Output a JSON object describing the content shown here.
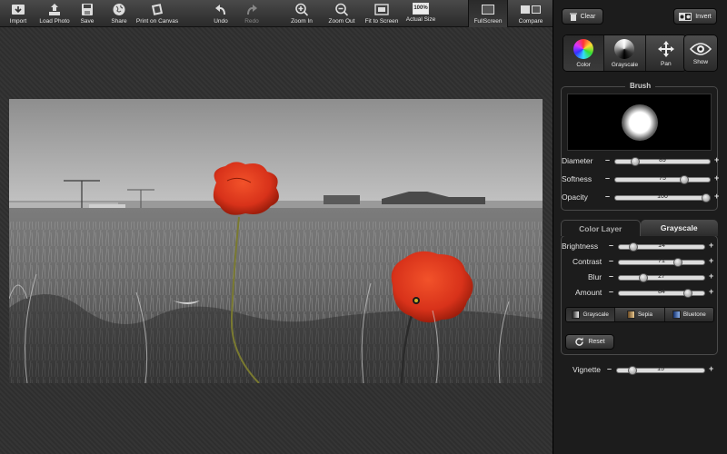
{
  "toolbar": {
    "import": "Import",
    "load_photo": "Load Photo",
    "save": "Save",
    "share": "Share",
    "print_on_canvas": "Print on Canvas",
    "undo": "Undo",
    "redo": "Redo",
    "zoom_in": "Zoom In",
    "zoom_out": "Zoom Out",
    "fit_to_screen": "Fit to Screen",
    "actual_size": "Actual Size",
    "actual_size_icon_text": "100%",
    "fullscreen": "FullScreen",
    "compare": "Compare"
  },
  "panel": {
    "clear": "Clear",
    "invert": "Invert",
    "tools": {
      "color": "Color",
      "grayscale": "Grayscale",
      "pan": "Pan",
      "show": "Show"
    },
    "brush": {
      "title": "Brush",
      "diameter_label": "Diameter",
      "diameter": "89",
      "diameter_pos": 0.19,
      "softness_label": "Softness",
      "softness": "75",
      "softness_pos": 0.75,
      "opacity_label": "Opacity",
      "opacity": "100",
      "opacity_pos": 1.0
    },
    "tabs": {
      "color_layer": "Color Layer",
      "grayscale": "Grayscale"
    },
    "adjust": {
      "brightness_label": "Brightness",
      "brightness": "14",
      "brightness_pos": 0.14,
      "contrast_label": "Contrast",
      "contrast": "71",
      "contrast_pos": 0.71,
      "blur_label": "Blur",
      "blur": "27",
      "blur_pos": 0.27,
      "amount_label": "Amount",
      "amount": "84",
      "amount_pos": 0.84
    },
    "presets": {
      "grayscale": "Grayscale",
      "sepia": "Sepia",
      "bluetone": "Bluetone"
    },
    "reset": "Reset",
    "vignette_label": "Vignette",
    "vignette": "15",
    "vignette_pos": 0.15
  },
  "colors": {
    "poppy": "#d8321a",
    "panel_bg": "#1c1c1c"
  }
}
